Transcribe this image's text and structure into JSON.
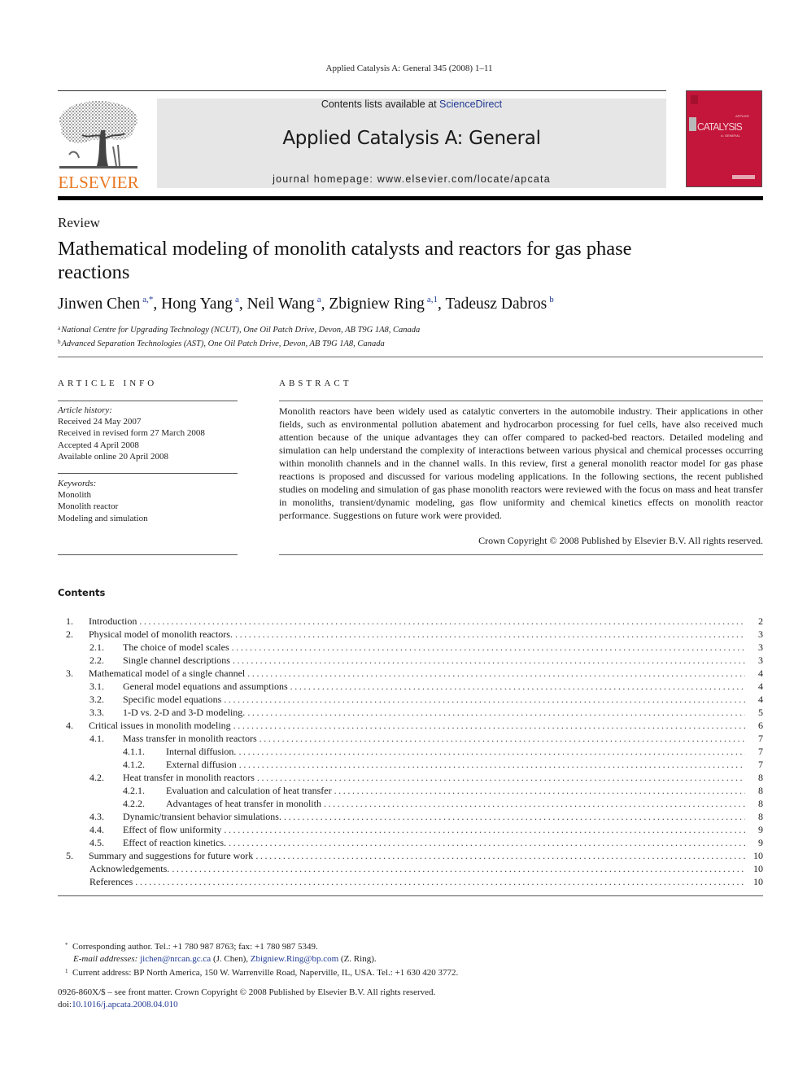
{
  "running_header": "Applied Catalysis A: General 345 (2008) 1–11",
  "publisher": {
    "name": "ELSEVIER",
    "color": "#e87722"
  },
  "banner": {
    "contents_prefix": "Contents lists available at ",
    "contents_link": "ScienceDirect",
    "journal_title": "Applied Catalysis A: General",
    "homepage": "journal homepage: www.elsevier.com/locate/apcata",
    "background": "#e6e6e6",
    "link_color": "#1f3a93"
  },
  "cover": {
    "wordmark": "CATALYSIS",
    "prefix": "APPLIED",
    "subtitle": "A: GENERAL",
    "color": "#c4153a"
  },
  "article": {
    "type": "Review",
    "title": "Mathematical modeling of monolith catalysts and reactors for gas phase reactions",
    "authors": [
      {
        "name": "Jinwen Chen",
        "sup": "a,*"
      },
      {
        "name": "Hong Yang",
        "sup": "a"
      },
      {
        "name": "Neil Wang",
        "sup": "a"
      },
      {
        "name": "Zbigniew Ring",
        "sup": "a,1"
      },
      {
        "name": "Tadeusz Dabros",
        "sup": "b"
      }
    ],
    "affiliations": [
      {
        "mark": "a",
        "text": "National Centre for Upgrading Technology (NCUT), One Oil Patch Drive, Devon, AB T9G 1A8, Canada"
      },
      {
        "mark": "b",
        "text": "Advanced Separation Technologies (AST), One Oil Patch Drive, Devon, AB T9G 1A8, Canada"
      }
    ]
  },
  "article_info": {
    "heading": "ARTICLE INFO",
    "history_label": "Article history:",
    "history": [
      "Received 24 May 2007",
      "Received in revised form 27 March 2008",
      "Accepted 4 April 2008",
      "Available online 20 April 2008"
    ],
    "keywords_label": "Keywords:",
    "keywords": [
      "Monolith",
      "Monolith reactor",
      "Modeling and simulation"
    ]
  },
  "abstract": {
    "heading": "ABSTRACT",
    "text": "Monolith reactors have been widely used as catalytic converters in the automobile industry. Their applications in other fields, such as environmental pollution abatement and hydrocarbon processing for fuel cells, have also received much attention because of the unique advantages they can offer compared to packed-bed reactors. Detailed modeling and simulation can help understand the complexity of interactions between various physical and chemical processes occurring within monolith channels and in the channel walls. In this review, first a general monolith reactor model for gas phase reactions is proposed and discussed for various modeling applications. In the following sections, the recent published studies on modeling and simulation of gas phase monolith reactors were reviewed with the focus on mass and heat transfer in monoliths, transient/dynamic modeling, gas flow uniformity and chemical kinetics effects on monolith reactor performance. Suggestions on future work were provided.",
    "copyright": "Crown Copyright © 2008 Published by Elsevier B.V. All rights reserved."
  },
  "contents": {
    "heading": "Contents",
    "entries": [
      {
        "num": "1.",
        "title": "Introduction",
        "page": "2",
        "level": 0
      },
      {
        "num": "2.",
        "title": "Physical model of monolith reactors.",
        "page": "3",
        "level": 0
      },
      {
        "num": "2.1.",
        "title": "The choice of model scales",
        "page": "3",
        "level": 1
      },
      {
        "num": "2.2.",
        "title": "Single channel descriptions",
        "page": "3",
        "level": 1
      },
      {
        "num": "3.",
        "title": "Mathematical model of a single channel",
        "page": "4",
        "level": 0
      },
      {
        "num": "3.1.",
        "title": "General model equations and assumptions",
        "page": "4",
        "level": 1
      },
      {
        "num": "3.2.",
        "title": "Specific model equations",
        "page": "4",
        "level": 1
      },
      {
        "num": "3.3.",
        "title": "1-D vs. 2-D and 3-D modeling.",
        "page": "5",
        "level": 1
      },
      {
        "num": "4.",
        "title": "Critical issues in monolith modeling",
        "page": "6",
        "level": 0
      },
      {
        "num": "4.1.",
        "title": "Mass transfer in monolith reactors",
        "page": "7",
        "level": 1
      },
      {
        "num": "4.1.1.",
        "title": "Internal diffusion.",
        "page": "7",
        "level": 2
      },
      {
        "num": "4.1.2.",
        "title": "External diffusion",
        "page": "7",
        "level": 2
      },
      {
        "num": "4.2.",
        "title": "Heat transfer in monolith reactors",
        "page": "8",
        "level": 1
      },
      {
        "num": "4.2.1.",
        "title": "Evaluation and calculation of heat transfer",
        "page": "8",
        "level": 2
      },
      {
        "num": "4.2.2.",
        "title": "Advantages of heat transfer in monolith",
        "page": "8",
        "level": 2
      },
      {
        "num": "4.3.",
        "title": "Dynamic/transient behavior simulations.",
        "page": "8",
        "level": 1
      },
      {
        "num": "4.4.",
        "title": "Effect of flow uniformity",
        "page": "9",
        "level": 1
      },
      {
        "num": "4.5.",
        "title": "Effect of reaction kinetics.",
        "page": "9",
        "level": 1
      },
      {
        "num": "5.",
        "title": "Summary and suggestions for future work",
        "page": "10",
        "level": 0
      },
      {
        "num": "",
        "title": "Acknowledgements.",
        "page": "10",
        "level": 0
      },
      {
        "num": "",
        "title": "References",
        "page": "10",
        "level": 0
      }
    ]
  },
  "footnotes": {
    "corresponding": "Corresponding author. Tel.: +1 780 987 8763; fax: +1 780 987 5349.",
    "email_label": "E-mail addresses:",
    "email1": "jichen@nrcan.gc.ca",
    "email1_owner": "(J. Chen),",
    "email2": "Zbigniew.Ring@bp.com",
    "email2_owner": "(Z. Ring).",
    "current_address": "Current address: BP North America, 150 W. Warrenville Road, Naperville, IL, USA. Tel.: +1 630 420 3772."
  },
  "legal": {
    "issn_line": "0926-860X/$ – see front matter. Crown Copyright © 2008 Published by Elsevier B.V. All rights reserved.",
    "doi_prefix": "doi:",
    "doi": "10.1016/j.apcata.2008.04.010"
  }
}
